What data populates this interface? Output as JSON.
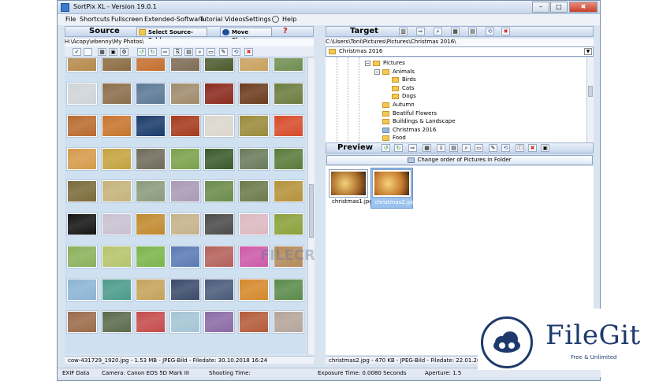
{
  "window": {
    "title": "SortPix XL - Version 19.0.1",
    "controls": {
      "minimize": "–",
      "maximize": "□",
      "close": "✖"
    }
  },
  "menu": [
    {
      "label": "File"
    },
    {
      "label": "Shortcuts"
    },
    {
      "label": "Fullscreen"
    },
    {
      "label": "Extended-Software"
    },
    {
      "label": "Tutorial Videos"
    },
    {
      "label": "Settings"
    },
    {
      "label": "Help"
    }
  ],
  "source": {
    "title": "Source",
    "select_folder_label": "Select Source-Folder",
    "move_photos_label": "Move Photos",
    "help_glyph": "?",
    "path": "H:\\Acopy\\ebenny\\My Photos\\",
    "status": "cow-431729_1920.jpg - 1.53 MB - JPEG-Bild - Filedate: 30.10.2018 16:24"
  },
  "target": {
    "title": "Target",
    "path": "C:\\Users\\Toni\\Pictures\\Pictures\\Christmas 2016\\",
    "folder_dropdown": "Christmas 2016",
    "tree": [
      {
        "label": "Pictures",
        "level": 0,
        "expander": "−"
      },
      {
        "label": "Animals",
        "level": 1,
        "expander": "−"
      },
      {
        "label": "Birds",
        "level": 2,
        "expander": ""
      },
      {
        "label": "Cats",
        "level": 2,
        "expander": ""
      },
      {
        "label": "Dogs",
        "level": 2,
        "expander": ""
      },
      {
        "label": "Autumn",
        "level": 1,
        "expander": ""
      },
      {
        "label": "Beatiful Flowers",
        "level": 1,
        "expander": ""
      },
      {
        "label": "Buildings & Landscape",
        "level": 1,
        "expander": ""
      },
      {
        "label": "Christmas 2016",
        "level": 1,
        "expander": ""
      },
      {
        "label": "Food",
        "level": 1,
        "expander": ""
      }
    ]
  },
  "preview": {
    "title": "Preview",
    "change_order_label": "Change order of Pictures in Folder",
    "items": [
      {
        "label": "christmas1.jpg",
        "selected": false
      },
      {
        "label": "christmas2.jpg",
        "selected": true
      }
    ],
    "status": "christmas2.jpg - 470 KB - JPEG-Bild - Filedate: 22.01.2019 15:32"
  },
  "exif": {
    "label": "EXIF Data",
    "camera": "Camera: Canon EOS 5D Mark III",
    "shooting_time": "Shooting Time:",
    "exposure": "Exposure Time: 0.0080 Seconds",
    "aperture": "Aperture: 1.5"
  },
  "thumb_colors": [
    "#b5894a",
    "#8a6a42",
    "#c46e2d",
    "#7d6b53",
    "#4b5a2d",
    "#c9a05e",
    "#6e8d4f",
    "#cfd4d8",
    "#8b6d4a",
    "#5b7895",
    "#a08a6c",
    "#8a2a1e",
    "#6b3b1e",
    "#6a7b3e",
    "#b86a2e",
    "#c7742c",
    "#1a3a6a",
    "#a53a1c",
    "#dcd6cc",
    "#9a8a3a",
    "#d64b2a",
    "#d59a4a",
    "#c4a23e",
    "#6e6a5a",
    "#7aa04a",
    "#3a5a2a",
    "#6a7a5a",
    "#5a7a3a",
    "#7a6a3a",
    "#c4b27a",
    "#8a9a7a",
    "#a89ab4",
    "#6a8a4a",
    "#6a7a4a",
    "#b5913a",
    "#141414",
    "#c8c0d0",
    "#c0892e",
    "#c4b28a",
    "#4a4a4a",
    "#dcb8c0",
    "#8aa03a",
    "#8ab05a",
    "#b4c46a",
    "#7ab44a",
    "#5a7ab4",
    "#b4605a",
    "#cc5aa8",
    "#b48a5a",
    "#8ab4d4",
    "#4a9a8a",
    "#c4a25a",
    "#3a4a6a",
    "#4a5a7a",
    "#d4882a",
    "#5a8a4a",
    "#9a6a4a",
    "#5a6a4a",
    "#c44a4a",
    "#a4c4d4",
    "#8a6aa4",
    "#b45a3a",
    "#b4a49a"
  ],
  "preview_colors": [
    "#a86a2a",
    "#c4782a"
  ],
  "watermarks": {
    "filegit": "FileGit",
    "filegit_sub": "Free & Unlimited",
    "filecr": "FILECR"
  }
}
